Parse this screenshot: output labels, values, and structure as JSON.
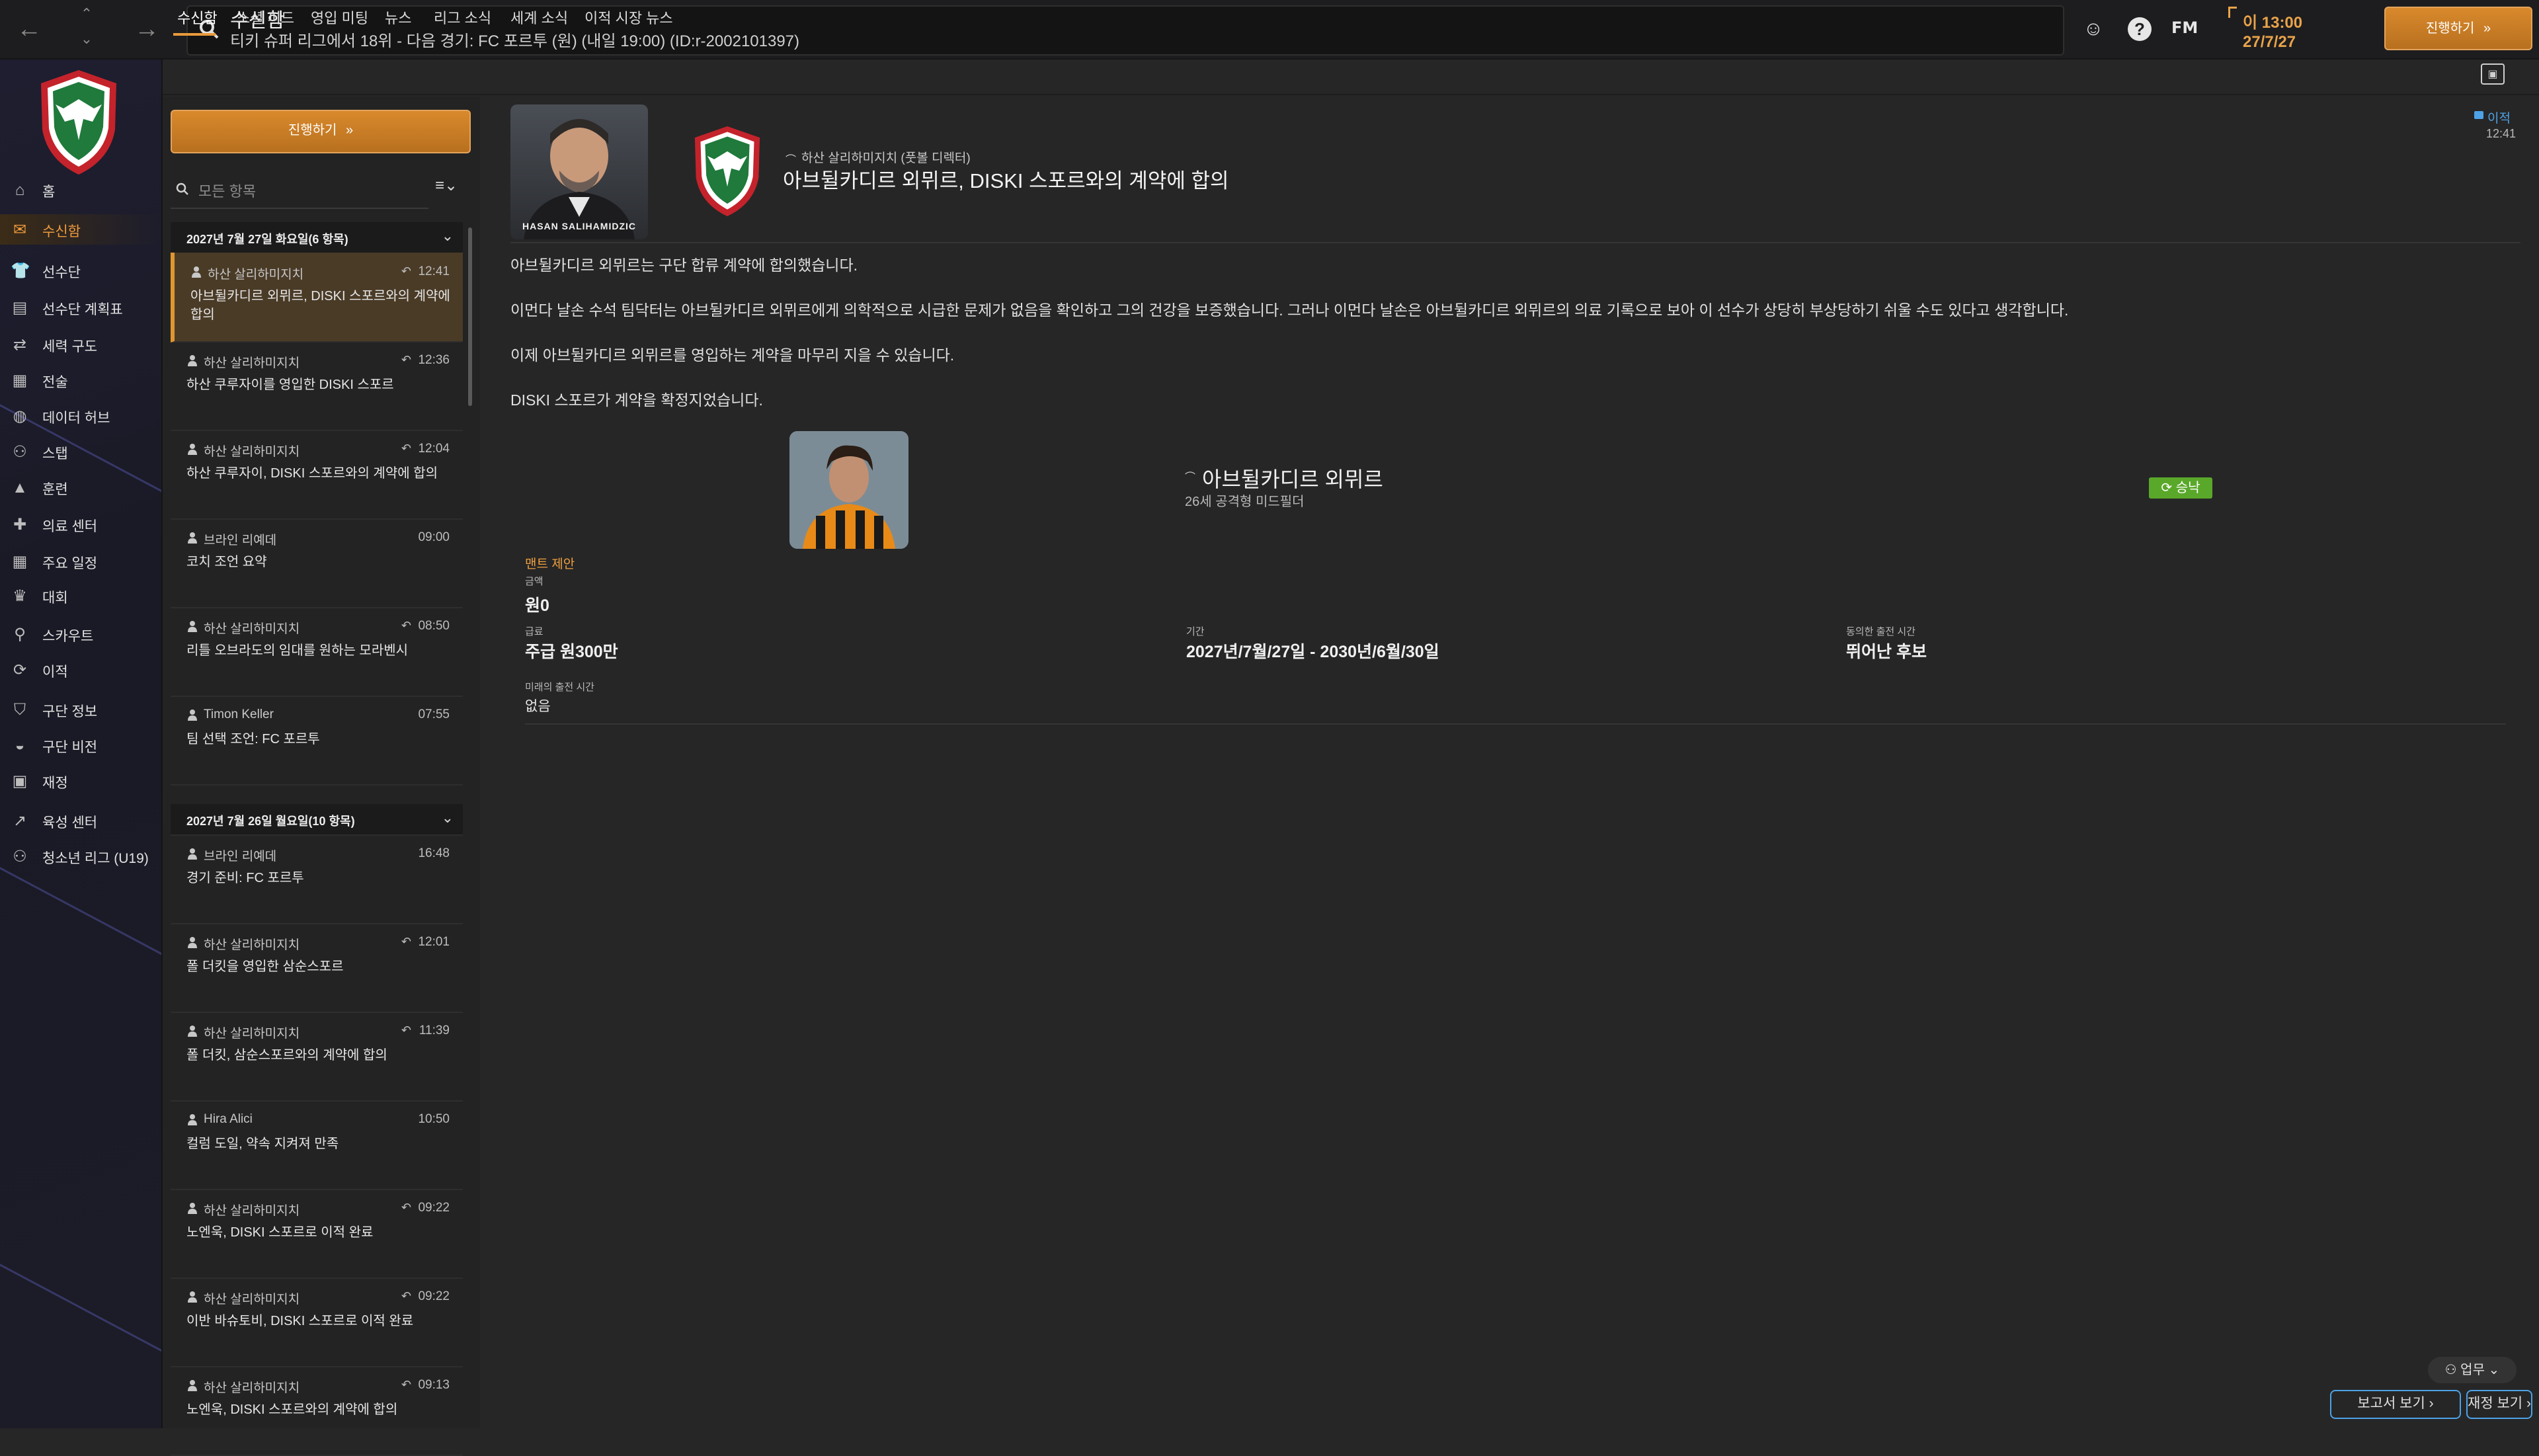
{
  "topbar": {
    "title": "수신함",
    "subtitle": "티키 슈퍼 리그에서 18위 - 다음 경기: FC 포르투 (원) (내일 19:00) (ID:r-2002101397)",
    "fm_label": "FM",
    "time": "이 13:00",
    "date": "27/7/27",
    "continue_label": "진행하기"
  },
  "sidebar": {
    "items": [
      {
        "label": "홈",
        "icon": "home-icon"
      },
      {
        "label": "수신함",
        "icon": "inbox-icon",
        "active": true
      },
      {
        "label": "선수단",
        "icon": "squad-icon"
      },
      {
        "label": "선수단 계획표",
        "icon": "planner-icon"
      },
      {
        "label": "세력 구도",
        "icon": "dynamics-icon"
      },
      {
        "label": "전술",
        "icon": "tactics-icon"
      },
      {
        "label": "데이터 허브",
        "icon": "data-hub-icon"
      },
      {
        "label": "스탭",
        "icon": "staff-icon"
      },
      {
        "label": "훈련",
        "icon": "training-icon"
      },
      {
        "label": "의료 센터",
        "icon": "medical-icon"
      },
      {
        "label": "주요 일정",
        "icon": "calendar-icon"
      },
      {
        "label": "대회",
        "icon": "trophy-icon"
      },
      {
        "label": "스카우트",
        "icon": "scouting-icon"
      },
      {
        "label": "이적",
        "icon": "transfers-icon"
      },
      {
        "label": "구단 정보",
        "icon": "club-info-icon"
      },
      {
        "label": "구단 비전",
        "icon": "club-vision-icon"
      },
      {
        "label": "재정",
        "icon": "finances-icon"
      },
      {
        "label": "육성 센터",
        "icon": "development-icon"
      },
      {
        "label": "청소년 리그 (U19)",
        "icon": "youth-icon"
      }
    ]
  },
  "tabs": [
    "수신함",
    "소셜 피드",
    "영입 미팅",
    "뉴스",
    "리그 소식",
    "세계 소식",
    "이적 시장 뉴스"
  ],
  "list": {
    "continue_label": "진행하기",
    "search_placeholder": "모든 항목",
    "groups": [
      {
        "header": "2027년 7월 27일 화요일(6 항목)",
        "messages": [
          {
            "sender": "하산 살리하미지치",
            "time": "12:41",
            "subject": "아브뒬카디르 외뮈르, DISKI 스포르와의 계약에 합의",
            "replied": true,
            "selected": true
          },
          {
            "sender": "하산 살리하미지치",
            "time": "12:36",
            "subject": "하산 쿠루자이를 영입한 DISKI 스포르",
            "replied": true
          },
          {
            "sender": "하산 살리하미지치",
            "time": "12:04",
            "subject": "하산 쿠루자이, DISKI 스포르와의 계약에 합의",
            "replied": true
          },
          {
            "sender": "브라인 리예데",
            "time": "09:00",
            "subject": "코치 조언 요약",
            "replied": false
          },
          {
            "sender": "하산 살리하미지치",
            "time": "08:50",
            "subject": "리틀 오브라도의 임대를 원하는 모라벤시",
            "replied": true
          },
          {
            "sender": "Timon Keller",
            "time": "07:55",
            "subject": "팀 선택 조언: FC 포르투",
            "replied": false
          }
        ]
      },
      {
        "header": "2027년 7월 26일 월요일(10 항목)",
        "messages": [
          {
            "sender": "브라인 리예데",
            "time": "16:48",
            "subject": "경기 준비: FC 포르투",
            "replied": false
          },
          {
            "sender": "하산 살리하미지치",
            "time": "12:01",
            "subject": "폴 더킷을 영입한 삼순스포르",
            "replied": true
          },
          {
            "sender": "하산 살리하미지치",
            "time": "11:39",
            "subject": "폴 더킷, 삼순스포르와의 계약에 합의",
            "replied": true
          },
          {
            "sender": "Hira Alici",
            "time": "10:50",
            "subject": "컬럼 도일, 약속 지켜져 만족",
            "replied": false
          },
          {
            "sender": "하산 살리하미지치",
            "time": "09:22",
            "subject": "노엔욱, DISKI 스포르로 이적 완료",
            "replied": true
          },
          {
            "sender": "하산 살리하미지치",
            "time": "09:22",
            "subject": "이반 바슈토비, DISKI 스포르로 이적 완료",
            "replied": true
          },
          {
            "sender": "하산 살리하미지치",
            "time": "09:13",
            "subject": "노엔욱, DISKI 스포르와의 계약에 합의",
            "replied": true
          }
        ]
      }
    ]
  },
  "message": {
    "manager_name": "HASAN SALIHAMIDZIC",
    "sender": "하산 살리하미지치 (풋볼 디렉터)",
    "subject": "아브뒬카디르 외뮈르, DISKI 스포르와의 계약에 합의",
    "tag": "이적",
    "tag_time": "12:41",
    "body": [
      "아브뒬카디르 외뮈르는 구단 합류 계약에 합의했습니다.",
      "이먼다 날손 수석 팀닥터는 아브뒬카디르 외뮈르에게 의학적으로 시급한 문제가 없음을 확인하고 그의 건강을 보증했습니다. 그러나 이먼다 날손은 아브뒬카디르 외뮈르의 의료 기록으로 보아 이 선수가 상당히 부상당하기 쉬울 수도 있다고 생각합니다.",
      "이제 아브뒬카디르 외뮈르를 영입하는 계약을 마무리 지을 수 있습니다.",
      "DISKI 스포르가 계약을 확정지었습니다."
    ],
    "player": {
      "name": "아브뒬카디르 외뮈르",
      "desc": "26세 공격형 미드필더",
      "status": "승낙"
    },
    "deal": {
      "section_label": "맨트 제안",
      "fee_label": "금액",
      "fee_value": "원0",
      "wage_label": "급료",
      "wage_value": "주급 원300만",
      "period_label": "기간",
      "period_value": "2027년/7월/27일 - 2030년/6월/30일",
      "playing_time_label": "동의한 출전 시간",
      "playing_time_value": "뛰어난 후보",
      "future_time_label": "미래의 출전 시간",
      "future_time_value": "없음"
    }
  },
  "bottom": {
    "role_label": "업무",
    "report_label": "보고서 보기",
    "finance_label": "재정 보기"
  },
  "colors": {
    "accent": "#e99a3b",
    "sidebar_bg": "#1c1c28",
    "status_green": "#5aa82a",
    "link_blue": "#4ea2e6"
  }
}
